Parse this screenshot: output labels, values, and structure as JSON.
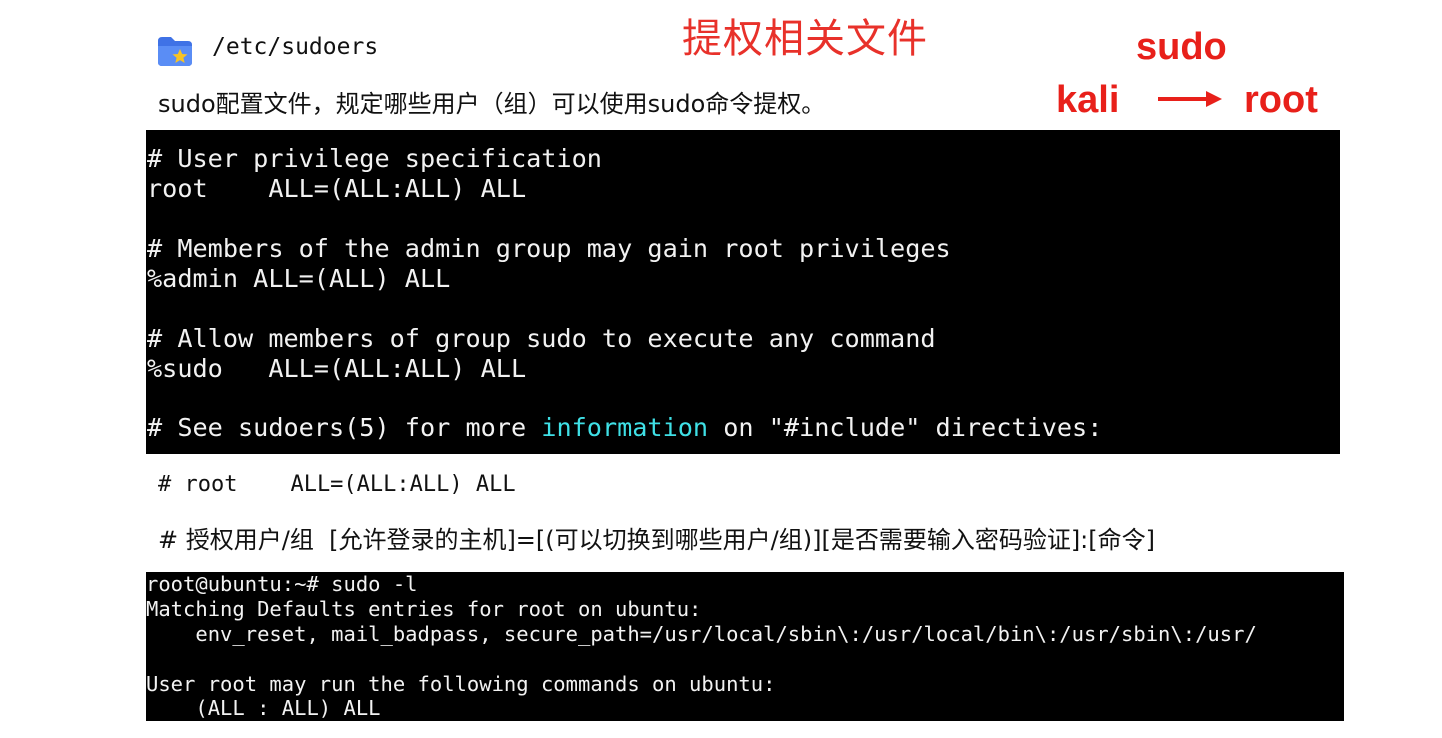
{
  "header": {
    "title": "提权相关文件",
    "file_icon": "folder-star-icon",
    "file_path": "/etc/sudoers",
    "description": "sudo配置文件，规定哪些用户（组）可以使用sudo命令提权。"
  },
  "side_note": {
    "top": "sudo",
    "from": "kali",
    "arrow": "long-right-arrow-icon",
    "to": "root",
    "color": "#e8201a"
  },
  "sudoers_excerpt": {
    "background": "#000000",
    "lines": [
      "# User privilege specification",
      "root    ALL=(ALL:ALL) ALL",
      "# Members of the admin group may gain root privileges",
      "%admin ALL=(ALL) ALL",
      "# Allow members of group sudo to execute any command",
      "%sudo   ALL=(ALL:ALL) ALL"
    ],
    "see_line": {
      "before": "# See sudoers(5) for more ",
      "highlight": "information",
      "after": " on \"#include\" directives:",
      "highlight_color": "#3fe0e6"
    }
  },
  "annotations": {
    "example": "# root    ALL=(ALL:ALL) ALL",
    "format": "# 授权用户/组  [允许登录的主机]=[(可以切换到哪些用户/组)][是否需要输入密码验证]:[命令]"
  },
  "sudo_l_output": {
    "lines": [
      "root@ubuntu:~# sudo -l",
      "Matching Defaults entries for root on ubuntu:",
      "    env_reset, mail_badpass, secure_path=/usr/local/sbin\\:/usr/local/bin\\:/usr/sbin\\:/usr/",
      "User root may run the following commands on ubuntu:",
      "    (ALL : ALL) ALL"
    ]
  }
}
